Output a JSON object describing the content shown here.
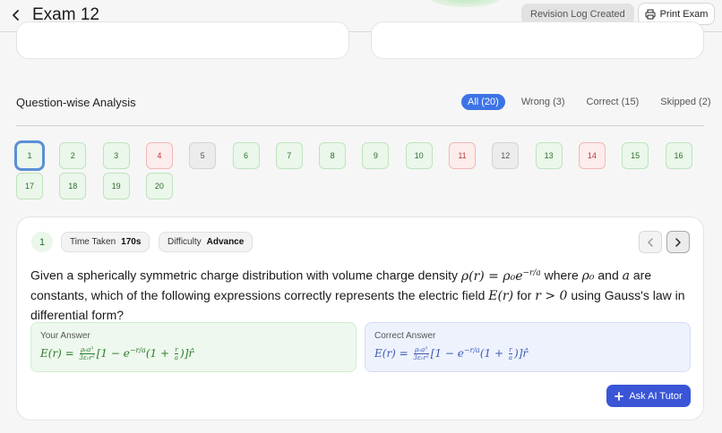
{
  "header": {
    "title": "Exam 12",
    "revision_badge": "Revision Log Created",
    "print_label": "Print Exam"
  },
  "analysis": {
    "title": "Question-wise Analysis",
    "filters": [
      {
        "label": "All (20)",
        "active": true
      },
      {
        "label": "Wrong (3)",
        "active": false
      },
      {
        "label": "Correct (15)",
        "active": false
      },
      {
        "label": "Skipped (2)",
        "active": false
      }
    ],
    "questions": [
      {
        "n": "1",
        "status": "correct",
        "selected": true
      },
      {
        "n": "2",
        "status": "correct"
      },
      {
        "n": "3",
        "status": "correct"
      },
      {
        "n": "4",
        "status": "wrong"
      },
      {
        "n": "5",
        "status": "skipped"
      },
      {
        "n": "6",
        "status": "correct"
      },
      {
        "n": "7",
        "status": "correct"
      },
      {
        "n": "8",
        "status": "correct"
      },
      {
        "n": "9",
        "status": "correct"
      },
      {
        "n": "10",
        "status": "correct"
      },
      {
        "n": "11",
        "status": "wrong"
      },
      {
        "n": "12",
        "status": "skipped"
      },
      {
        "n": "13",
        "status": "correct"
      },
      {
        "n": "14",
        "status": "wrong"
      },
      {
        "n": "15",
        "status": "correct"
      },
      {
        "n": "16",
        "status": "correct"
      },
      {
        "n": "17",
        "status": "correct"
      },
      {
        "n": "18",
        "status": "correct"
      },
      {
        "n": "19",
        "status": "correct"
      },
      {
        "n": "20",
        "status": "correct"
      }
    ]
  },
  "detail": {
    "number": "1",
    "time_label": "Time Taken",
    "time_value": "170s",
    "difficulty_label": "Difficulty",
    "difficulty_value": "Advance",
    "question": {
      "p1": "Given a spherically symmetric charge distribution with volume charge density ",
      "m1": "ρ(r) = ρ₀e",
      "m1sup": "−r/a",
      "p2": " where ",
      "m2": "ρ₀",
      "p3": " and ",
      "m3": "a",
      "p4": " are constants, which of the following expressions correctly represents the electric field ",
      "m4": "E(r)",
      "p5": " for ",
      "m5": "r > 0",
      "p6": " using Gauss's law in differential form?"
    },
    "your_answer_label": "Your Answer",
    "correct_answer_label": "Correct Answer",
    "formula": {
      "lhs": "E(r) = ",
      "num": "ρ₀a³",
      "den": "3ε₀r²",
      "bracket_open": "[1 − e",
      "exp": "−r/a",
      "paren": "(1 + ",
      "rnum": "r",
      "rden": "a",
      "close": ")]r̂"
    },
    "tutor_label": "Ask AI Tutor"
  },
  "colors": {
    "accent": "#3d73e6",
    "tutor": "#3a55d6",
    "correct": "#eaf7ea",
    "wrong": "#fdecec",
    "skipped": "#ececec"
  }
}
